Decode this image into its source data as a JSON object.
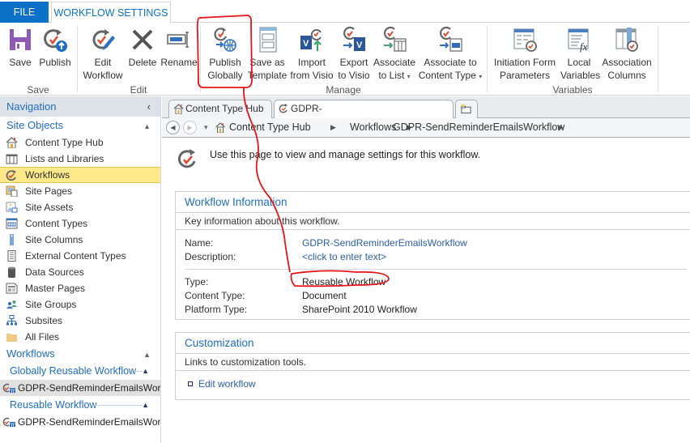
{
  "ribbon": {
    "tabs": [
      {
        "label": "FILE",
        "active": false
      },
      {
        "label": "WORKFLOW SETTINGS",
        "active": true
      }
    ],
    "groups": [
      {
        "label": "Save",
        "buttons": [
          {
            "id": "save",
            "line1": "Save",
            "line2": ""
          },
          {
            "id": "publish",
            "line1": "Publish",
            "line2": ""
          }
        ]
      },
      {
        "label": "Edit",
        "buttons": [
          {
            "id": "edit-workflow",
            "line1": "Edit",
            "line2": "Workflow"
          },
          {
            "id": "delete",
            "line1": "Delete",
            "line2": ""
          },
          {
            "id": "rename",
            "line1": "Rename",
            "line2": ""
          }
        ]
      },
      {
        "label": "Manage",
        "buttons": [
          {
            "id": "publish-globally",
            "line1": "Publish",
            "line2": "Globally"
          },
          {
            "id": "save-as-template",
            "line1": "Save as",
            "line2": "Template"
          },
          {
            "id": "import-from-visio",
            "line1": "Import",
            "line2": "from Visio"
          },
          {
            "id": "export-to-visio",
            "line1": "Export",
            "line2": "to Visio"
          },
          {
            "id": "associate-to-list",
            "line1": "Associate",
            "line2": "to List",
            "dropdown": "▾"
          },
          {
            "id": "associate-to-content-type",
            "line1": "Associate to",
            "line2": "Content Type",
            "dropdown": "▾"
          }
        ]
      },
      {
        "label": "Variables",
        "buttons": [
          {
            "id": "initiation-form-parameters",
            "line1": "Initiation Form",
            "line2": "Parameters"
          },
          {
            "id": "local-variables",
            "line1": "Local",
            "line2": "Variables"
          },
          {
            "id": "association-columns",
            "line1": "Association",
            "line2": "Columns"
          }
        ]
      }
    ]
  },
  "nav": {
    "header": "Navigation",
    "collapse_glyph": "‹",
    "site_objects_label": "Site Objects",
    "section_chevron": "▲",
    "items": [
      {
        "label": "Content Type Hub",
        "icon": "home-icon"
      },
      {
        "label": "Lists and Libraries",
        "icon": "list-icon"
      },
      {
        "label": "Workflows",
        "icon": "workflow-icon",
        "selected": true
      },
      {
        "label": "Site Pages",
        "icon": "site-pages-icon"
      },
      {
        "label": "Site Assets",
        "icon": "site-assets-icon"
      },
      {
        "label": "Content Types",
        "icon": "content-types-icon"
      },
      {
        "label": "Site Columns",
        "icon": "site-columns-icon"
      },
      {
        "label": "External Content Types",
        "icon": "external-content-types-icon"
      },
      {
        "label": "Data Sources",
        "icon": "database-icon"
      },
      {
        "label": "Master Pages",
        "icon": "master-pages-icon"
      },
      {
        "label": "Site Groups",
        "icon": "groups-icon"
      },
      {
        "label": "Subsites",
        "icon": "subsites-icon"
      },
      {
        "label": "All Files",
        "icon": "folder-icon"
      }
    ],
    "workflows_label": "Workflows",
    "subsections": [
      {
        "label": "Globally Reusable Workflow",
        "items": [
          "GDPR-SendReminderEmailsWor..."
        ]
      },
      {
        "label": "Reusable Workflow",
        "items": [
          "GDPR-SendReminderEmailsWor..."
        ]
      }
    ]
  },
  "doc_tabs": [
    {
      "label": "Content Type Hub",
      "icon": "home-icon",
      "active": false
    },
    {
      "label": "GDPR-SendReminderEmailsWorkflow",
      "icon": "workflow-icon",
      "active": true
    }
  ],
  "breadcrumb": {
    "back_glyph": "◀",
    "forward_glyph": "▶",
    "dropdown_glyph": "▾",
    "separator": "▶",
    "segments": [
      "Content Type Hub",
      "Workflows",
      "GDPR-SendReminderEmailsWorkflow"
    ]
  },
  "page": {
    "intro": "Use this page to view and manage settings for this workflow.",
    "workflow_info": {
      "title": "Workflow Information",
      "description": "Key information about this workflow.",
      "fields": [
        {
          "label": "Name:",
          "value": "GDPR-SendReminderEmailsWorkflow",
          "link": true
        },
        {
          "label": "Description:",
          "value": "<click to enter text>",
          "link": true
        },
        {
          "label": "Type:",
          "value": "Reusable Workflow",
          "link": false,
          "annotated": true
        },
        {
          "label": "Content Type:",
          "value": "Document",
          "link": false
        },
        {
          "label": "Platform Type:",
          "value": "SharePoint 2010 Workflow",
          "link": false
        }
      ]
    },
    "customization": {
      "title": "Customization",
      "description": "Links to customization tools.",
      "links": [
        "Edit workflow"
      ]
    }
  },
  "colors": {
    "accent": "#0d72c7",
    "link": "#1e6ec2",
    "selected_nav": "#fde98a",
    "annotation": "#e8141a"
  }
}
